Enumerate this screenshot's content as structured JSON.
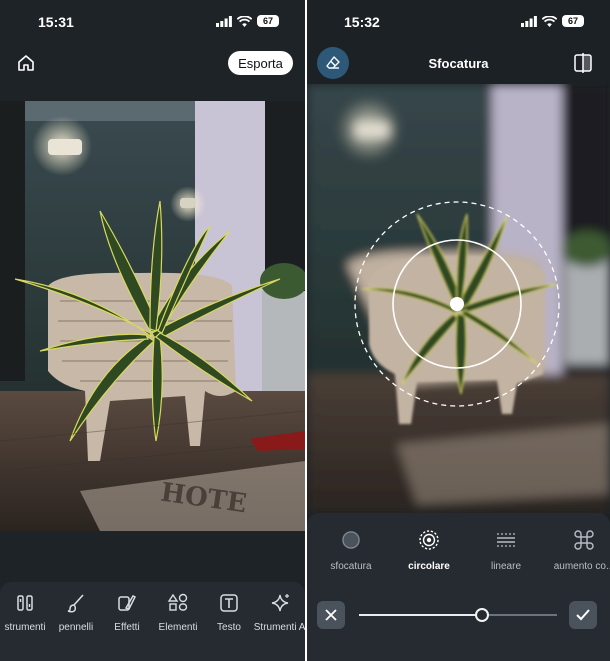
{
  "left_screen": {
    "status": {
      "time": "15:31",
      "battery": "67"
    },
    "header": {
      "export_label": "Esporta"
    },
    "toolbar": {
      "items": [
        {
          "label": "strumenti",
          "icon": "tools-icon"
        },
        {
          "label": "pennelli",
          "icon": "brush-icon"
        },
        {
          "label": "Effetti",
          "icon": "effects-icon"
        },
        {
          "label": "Elementi",
          "icon": "elements-icon"
        },
        {
          "label": "Testo",
          "icon": "text-icon"
        },
        {
          "label": "Strumenti AI",
          "icon": "ai-sparkle-icon"
        }
      ]
    }
  },
  "right_screen": {
    "status": {
      "time": "15:32",
      "battery": "67"
    },
    "header": {
      "title": "Sfocatura"
    },
    "blur_modes": [
      {
        "label": "sfocatura",
        "icon": "blur-dot-icon",
        "active": false
      },
      {
        "label": "circolare",
        "icon": "radial-icon",
        "active": true
      },
      {
        "label": "lineare",
        "icon": "linear-icon",
        "active": false
      },
      {
        "label": "aumento co...",
        "icon": "command-icon",
        "active": false
      }
    ],
    "intensity": 0.62
  },
  "colors": {
    "panel_bg": "#262b31",
    "screen_bg": "#1e2328",
    "accent_button": "#2e5878",
    "action_button": "#4a525b",
    "text_primary": "#ffffff"
  }
}
